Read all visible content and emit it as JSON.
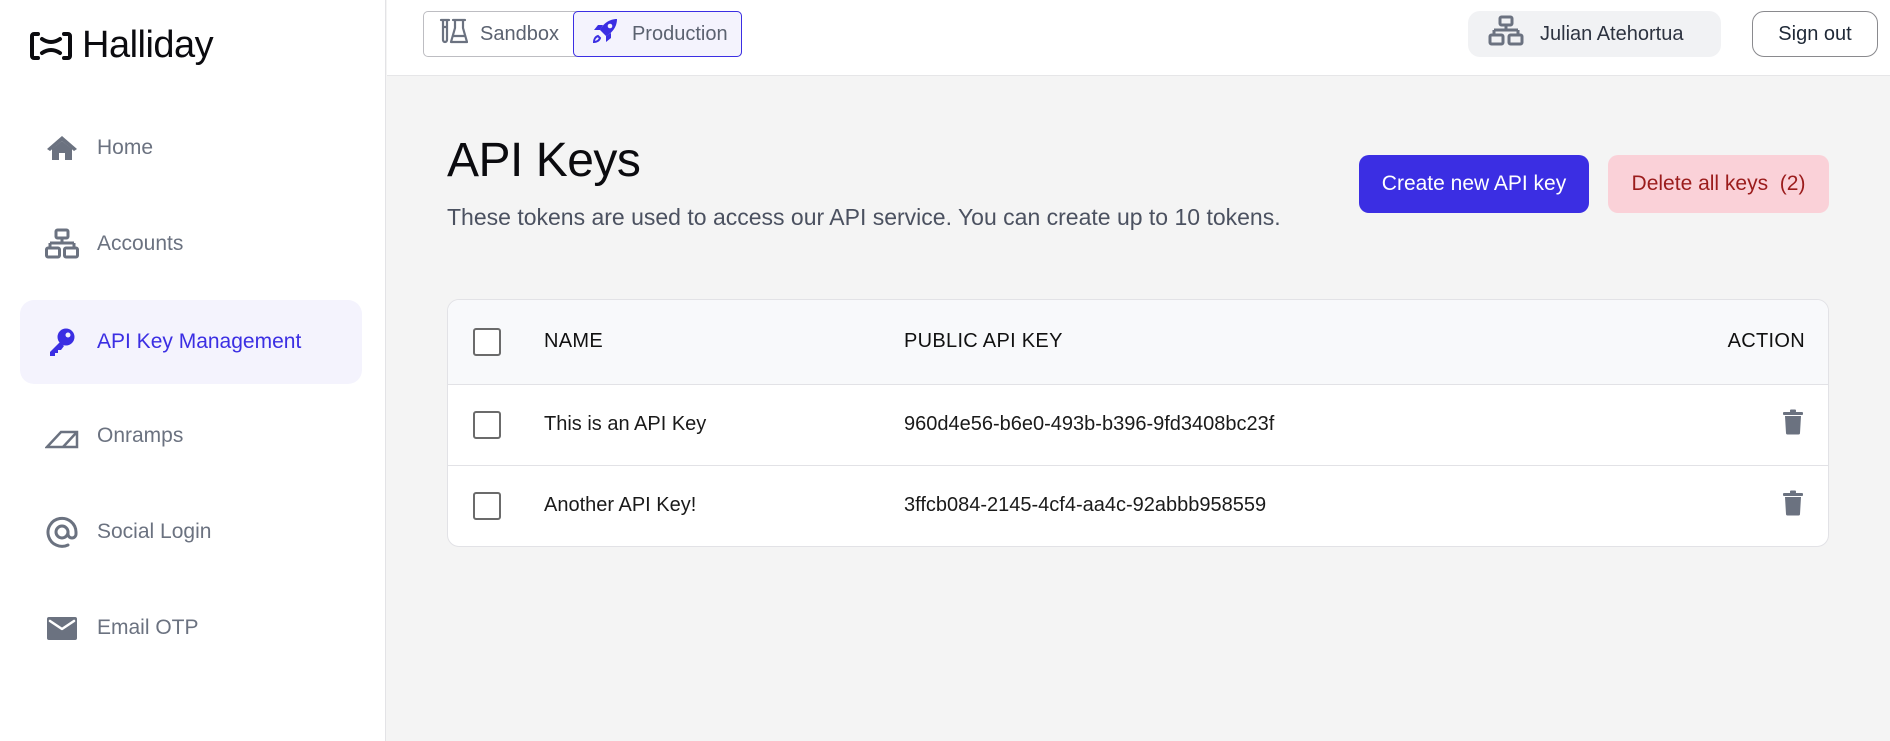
{
  "brand": {
    "name": "Halliday",
    "accent": "#3b2ee3"
  },
  "sidebar": {
    "items": [
      {
        "label": "Home",
        "icon": "home-icon",
        "active": false
      },
      {
        "label": "Accounts",
        "icon": "network-icon",
        "active": false
      },
      {
        "label": "API Key Management",
        "icon": "key-icon",
        "active": true
      },
      {
        "label": "Onramps",
        "icon": "ramp-icon",
        "active": false
      },
      {
        "label": "Social Login",
        "icon": "at-icon",
        "active": false
      },
      {
        "label": "Email OTP",
        "icon": "mail-icon",
        "active": false
      }
    ]
  },
  "header": {
    "environments": [
      {
        "label": "Sandbox",
        "icon": "flask-icon",
        "active": false
      },
      {
        "label": "Production",
        "icon": "rocket-icon",
        "active": true
      }
    ],
    "user": {
      "name": "Julian Atehortua",
      "icon": "network-icon"
    },
    "sign_out_label": "Sign out"
  },
  "main": {
    "title": "API Keys",
    "subtitle": "These tokens are used to access our API service. You can create up to 10 tokens.",
    "create_button_label": "Create new API key",
    "delete_all_button_label": "Delete all keys  (2)",
    "delete_all_count": 2,
    "table": {
      "columns": [
        "NAME",
        "PUBLIC API KEY",
        "ACTION"
      ],
      "rows": [
        {
          "name": "This is an API Key",
          "public_key": "960d4e56-b6e0-493b-b396-9fd3408bc23f",
          "action_icon": "trash-icon"
        },
        {
          "name": "Another API Key!",
          "public_key": "3ffcb084-2145-4cf4-aa4c-92abbb958559",
          "action_icon": "trash-icon"
        }
      ]
    }
  },
  "colors": {
    "primary": "#3b2ee3",
    "danger_bg": "#fad1d8",
    "danger_text": "#9b1c1c",
    "muted_text": "#6b7280",
    "active_nav_bg": "#f4f3fd"
  }
}
